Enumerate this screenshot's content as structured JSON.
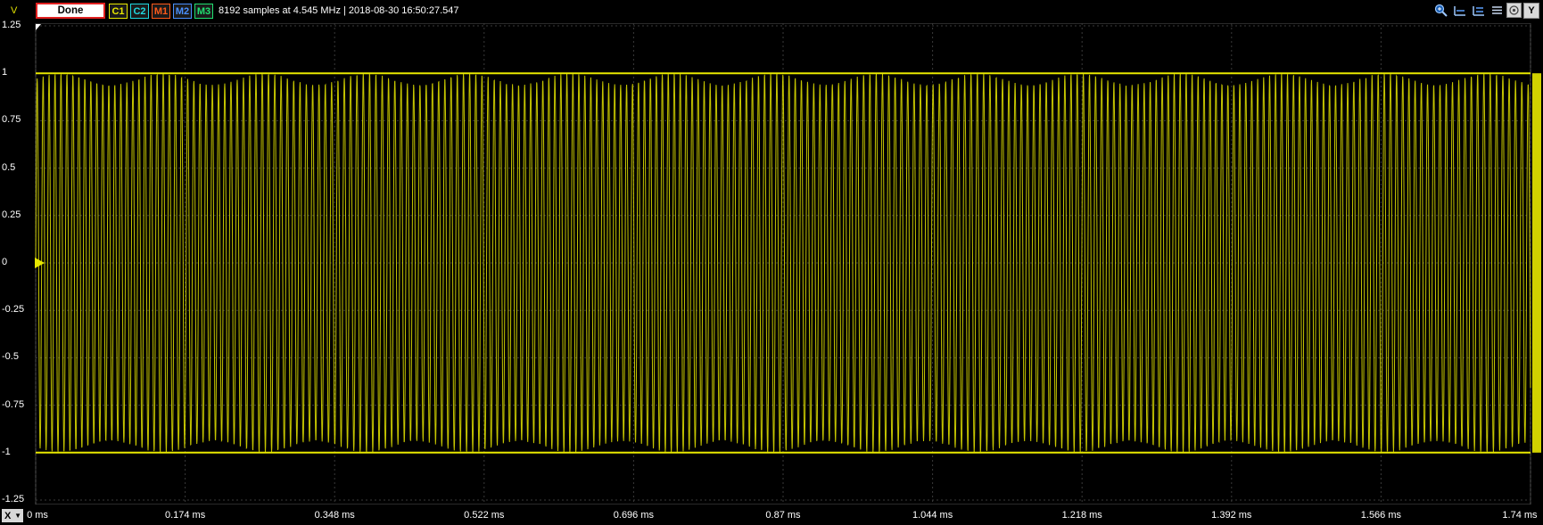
{
  "toolbar": {
    "unit": "V",
    "status_button": "Done",
    "channels": [
      {
        "label": "C1",
        "color": "#e8e800"
      },
      {
        "label": "C2",
        "color": "#20d8e0"
      },
      {
        "label": "M1",
        "color": "#ff5a1a"
      },
      {
        "label": "M2",
        "color": "#4a90ff"
      },
      {
        "label": "M3",
        "color": "#20e070"
      }
    ],
    "info": "8192 samples at 4.545 MHz | 2018-08-30 16:50:27.547",
    "icons": [
      "zoom-icon",
      "cursor-horizontal-icon",
      "cursor-vertical-icon",
      "list-icon",
      "snapshot-icon"
    ],
    "y_button": "Y"
  },
  "y_axis": {
    "tick_labels": [
      "1.25",
      "1",
      "0.75",
      "0.5",
      "0.25",
      "0",
      "-0.25",
      "-0.5",
      "-0.75",
      "-1",
      "-1.25"
    ]
  },
  "x_axis": {
    "button": "X",
    "tick_labels": [
      "0 ms",
      "0.174 ms",
      "0.348 ms",
      "0.522 ms",
      "0.696 ms",
      "0.87 ms",
      "1.044 ms",
      "1.218 ms",
      "1.392 ms",
      "1.566 ms",
      "1.74 ms"
    ]
  },
  "chart_data": {
    "type": "line",
    "series": [
      {
        "name": "C1",
        "color": "#e8e800"
      }
    ],
    "ylim": [
      -1.25,
      1.25
    ],
    "xlim": [
      0,
      1.74
    ],
    "x_unit": "ms",
    "y_unit": "V",
    "amplitude": 1,
    "samples": 8192,
    "sample_rate": "4.545 MHz",
    "grid": true
  }
}
